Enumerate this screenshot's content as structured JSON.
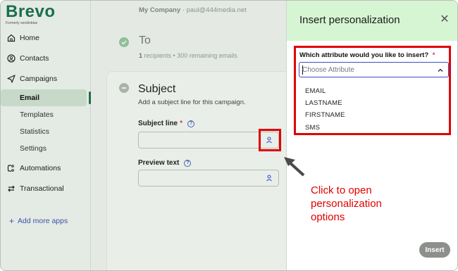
{
  "brand": {
    "name": "Brevo",
    "tagline": "Formerly sendinblue"
  },
  "sidebar": {
    "items": [
      {
        "label": "Home",
        "icon": "home-icon"
      },
      {
        "label": "Contacts",
        "icon": "contacts-icon"
      },
      {
        "label": "Campaigns",
        "icon": "send-icon"
      }
    ],
    "campaign_sub": [
      "Email",
      "Templates",
      "Statistics",
      "Settings"
    ],
    "items2": [
      {
        "label": "Automations",
        "icon": "automations-icon"
      },
      {
        "label": "Transactional",
        "icon": "transactional-icon"
      }
    ],
    "add_apps": "Add more apps"
  },
  "account": {
    "company": "My Company",
    "email": "paul@444media.net"
  },
  "steps": {
    "to": {
      "title": "To",
      "count": "1",
      "subtitle": "recipients • 300 remaining emails"
    },
    "subject": {
      "title": "Subject",
      "description": "Add a subject line for this campaign.",
      "subject_line_label": "Subject line",
      "preview_text_label": "Preview text"
    }
  },
  "panel": {
    "title": "Insert personalization",
    "question": "Which attribute would you like to insert?",
    "select_placeholder": "Choose Attribute",
    "options": [
      "EMAIL",
      "LASTNAME",
      "FIRSTNAME",
      "SMS"
    ],
    "insert_label": "Insert"
  },
  "annotation": {
    "callout": "Click to open personalization options"
  },
  "colors": {
    "brand": "#1b6e4f",
    "highlight": "#e00000",
    "panel_header": "#d6f5d3",
    "select_border": "#3c4fc9"
  }
}
